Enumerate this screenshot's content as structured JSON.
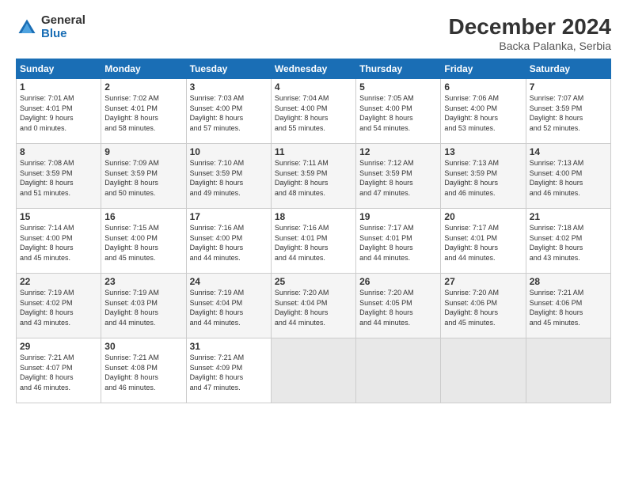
{
  "header": {
    "logo_general": "General",
    "logo_blue": "Blue",
    "title": "December 2024",
    "location": "Backa Palanka, Serbia"
  },
  "weekdays": [
    "Sunday",
    "Monday",
    "Tuesday",
    "Wednesday",
    "Thursday",
    "Friday",
    "Saturday"
  ],
  "weeks": [
    [
      {
        "day": "1",
        "info": "Sunrise: 7:01 AM\nSunset: 4:01 PM\nDaylight: 9 hours\nand 0 minutes."
      },
      {
        "day": "2",
        "info": "Sunrise: 7:02 AM\nSunset: 4:01 PM\nDaylight: 8 hours\nand 58 minutes."
      },
      {
        "day": "3",
        "info": "Sunrise: 7:03 AM\nSunset: 4:00 PM\nDaylight: 8 hours\nand 57 minutes."
      },
      {
        "day": "4",
        "info": "Sunrise: 7:04 AM\nSunset: 4:00 PM\nDaylight: 8 hours\nand 55 minutes."
      },
      {
        "day": "5",
        "info": "Sunrise: 7:05 AM\nSunset: 4:00 PM\nDaylight: 8 hours\nand 54 minutes."
      },
      {
        "day": "6",
        "info": "Sunrise: 7:06 AM\nSunset: 4:00 PM\nDaylight: 8 hours\nand 53 minutes."
      },
      {
        "day": "7",
        "info": "Sunrise: 7:07 AM\nSunset: 3:59 PM\nDaylight: 8 hours\nand 52 minutes."
      }
    ],
    [
      {
        "day": "8",
        "info": "Sunrise: 7:08 AM\nSunset: 3:59 PM\nDaylight: 8 hours\nand 51 minutes."
      },
      {
        "day": "9",
        "info": "Sunrise: 7:09 AM\nSunset: 3:59 PM\nDaylight: 8 hours\nand 50 minutes."
      },
      {
        "day": "10",
        "info": "Sunrise: 7:10 AM\nSunset: 3:59 PM\nDaylight: 8 hours\nand 49 minutes."
      },
      {
        "day": "11",
        "info": "Sunrise: 7:11 AM\nSunset: 3:59 PM\nDaylight: 8 hours\nand 48 minutes."
      },
      {
        "day": "12",
        "info": "Sunrise: 7:12 AM\nSunset: 3:59 PM\nDaylight: 8 hours\nand 47 minutes."
      },
      {
        "day": "13",
        "info": "Sunrise: 7:13 AM\nSunset: 3:59 PM\nDaylight: 8 hours\nand 46 minutes."
      },
      {
        "day": "14",
        "info": "Sunrise: 7:13 AM\nSunset: 4:00 PM\nDaylight: 8 hours\nand 46 minutes."
      }
    ],
    [
      {
        "day": "15",
        "info": "Sunrise: 7:14 AM\nSunset: 4:00 PM\nDaylight: 8 hours\nand 45 minutes."
      },
      {
        "day": "16",
        "info": "Sunrise: 7:15 AM\nSunset: 4:00 PM\nDaylight: 8 hours\nand 45 minutes."
      },
      {
        "day": "17",
        "info": "Sunrise: 7:16 AM\nSunset: 4:00 PM\nDaylight: 8 hours\nand 44 minutes."
      },
      {
        "day": "18",
        "info": "Sunrise: 7:16 AM\nSunset: 4:01 PM\nDaylight: 8 hours\nand 44 minutes."
      },
      {
        "day": "19",
        "info": "Sunrise: 7:17 AM\nSunset: 4:01 PM\nDaylight: 8 hours\nand 44 minutes."
      },
      {
        "day": "20",
        "info": "Sunrise: 7:17 AM\nSunset: 4:01 PM\nDaylight: 8 hours\nand 44 minutes."
      },
      {
        "day": "21",
        "info": "Sunrise: 7:18 AM\nSunset: 4:02 PM\nDaylight: 8 hours\nand 43 minutes."
      }
    ],
    [
      {
        "day": "22",
        "info": "Sunrise: 7:19 AM\nSunset: 4:02 PM\nDaylight: 8 hours\nand 43 minutes."
      },
      {
        "day": "23",
        "info": "Sunrise: 7:19 AM\nSunset: 4:03 PM\nDaylight: 8 hours\nand 44 minutes."
      },
      {
        "day": "24",
        "info": "Sunrise: 7:19 AM\nSunset: 4:04 PM\nDaylight: 8 hours\nand 44 minutes."
      },
      {
        "day": "25",
        "info": "Sunrise: 7:20 AM\nSunset: 4:04 PM\nDaylight: 8 hours\nand 44 minutes."
      },
      {
        "day": "26",
        "info": "Sunrise: 7:20 AM\nSunset: 4:05 PM\nDaylight: 8 hours\nand 44 minutes."
      },
      {
        "day": "27",
        "info": "Sunrise: 7:20 AM\nSunset: 4:06 PM\nDaylight: 8 hours\nand 45 minutes."
      },
      {
        "day": "28",
        "info": "Sunrise: 7:21 AM\nSunset: 4:06 PM\nDaylight: 8 hours\nand 45 minutes."
      }
    ],
    [
      {
        "day": "29",
        "info": "Sunrise: 7:21 AM\nSunset: 4:07 PM\nDaylight: 8 hours\nand 46 minutes."
      },
      {
        "day": "30",
        "info": "Sunrise: 7:21 AM\nSunset: 4:08 PM\nDaylight: 8 hours\nand 46 minutes."
      },
      {
        "day": "31",
        "info": "Sunrise: 7:21 AM\nSunset: 4:09 PM\nDaylight: 8 hours\nand 47 minutes."
      },
      null,
      null,
      null,
      null
    ]
  ]
}
